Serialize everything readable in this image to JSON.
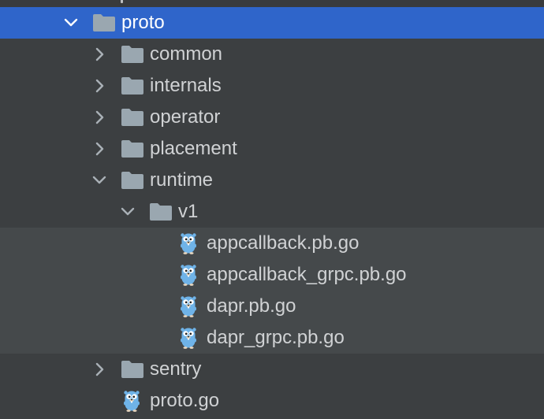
{
  "colors": {
    "panel_bg": "#3c3f41",
    "selection_bg": "#2f65ca",
    "shaded_bg": "#45494b",
    "text": "#d0d2d4",
    "folder": "#9aa7b0",
    "arrow": "#a9b0b6",
    "gopher": "#6fb3e8"
  },
  "tree": {
    "rows": [
      {
        "label": "proto",
        "type": "folder",
        "expanded": true,
        "selected": true,
        "icon": "folder-icon"
      },
      {
        "label": "common",
        "type": "folder",
        "expanded": false,
        "icon": "folder-icon"
      },
      {
        "label": "internals",
        "type": "folder",
        "expanded": false,
        "icon": "folder-icon"
      },
      {
        "label": "operator",
        "type": "folder",
        "expanded": false,
        "icon": "folder-icon"
      },
      {
        "label": "placement",
        "type": "folder",
        "expanded": false,
        "icon": "folder-icon"
      },
      {
        "label": "runtime",
        "type": "folder",
        "expanded": true,
        "icon": "folder-icon"
      },
      {
        "label": "v1",
        "type": "folder",
        "expanded": true,
        "icon": "folder-icon"
      },
      {
        "label": "appcallback.pb.go",
        "type": "file",
        "icon": "go-gopher-icon"
      },
      {
        "label": "appcallback_grpc.pb.go",
        "type": "file",
        "icon": "go-gopher-icon"
      },
      {
        "label": "dapr.pb.go",
        "type": "file",
        "icon": "go-gopher-icon"
      },
      {
        "label": "dapr_grpc.pb.go",
        "type": "file",
        "icon": "go-gopher-icon"
      },
      {
        "label": "sentry",
        "type": "folder",
        "expanded": false,
        "icon": "folder-icon"
      },
      {
        "label": "proto.go",
        "type": "file",
        "icon": "go-gopher-icon"
      }
    ]
  }
}
